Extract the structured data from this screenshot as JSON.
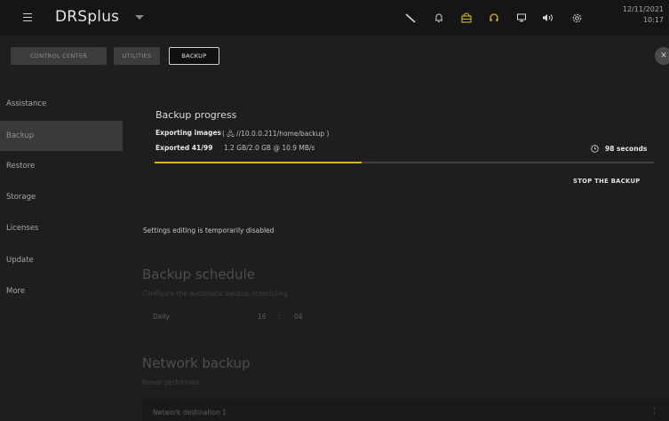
{
  "app": {
    "title": "DRSplus"
  },
  "clock": {
    "date": "12/11/2021",
    "time": "10:17"
  },
  "toolbar": {
    "icons": [
      "wrench-icon",
      "bell-icon",
      "sync-icon",
      "headset-icon",
      "monitor-icon",
      "volume-icon",
      "gear-icon"
    ],
    "accent_color": "#d6b90e"
  },
  "tabs": [
    {
      "label": "CONTROL CENTER"
    },
    {
      "label": "UTILITIES"
    },
    {
      "label": "BACKUP"
    }
  ],
  "sidebar": {
    "items": [
      {
        "label": "Assistance"
      },
      {
        "label": "Backup"
      },
      {
        "label": "Restore"
      },
      {
        "label": "Storage"
      },
      {
        "label": "Licenses"
      },
      {
        "label": "Update"
      },
      {
        "label": "More"
      }
    ]
  },
  "backup_progress": {
    "title": "Backup progress",
    "status": "Exporting images",
    "path": "( 🖧 //10.0.0.211/home/backup )",
    "exported_label": "Exported 41/99",
    "detail": "1.2 GB/2.0 GB  @ 10.9 MB/s",
    "time_left": "98 seconds",
    "progress_fraction": 0.414,
    "stop_label": "STOP THE BACKUP"
  },
  "notice": "Settings editing is temporarily disabled",
  "schedule": {
    "title": "Backup schedule",
    "subtitle": "Configure the automatic backup scheduling",
    "frequency": "Daily",
    "hour": "16",
    "separator": ":",
    "minute": "04"
  },
  "network": {
    "title": "Network backup",
    "subtitle": "Never performed",
    "destination": "Network destination 1"
  }
}
